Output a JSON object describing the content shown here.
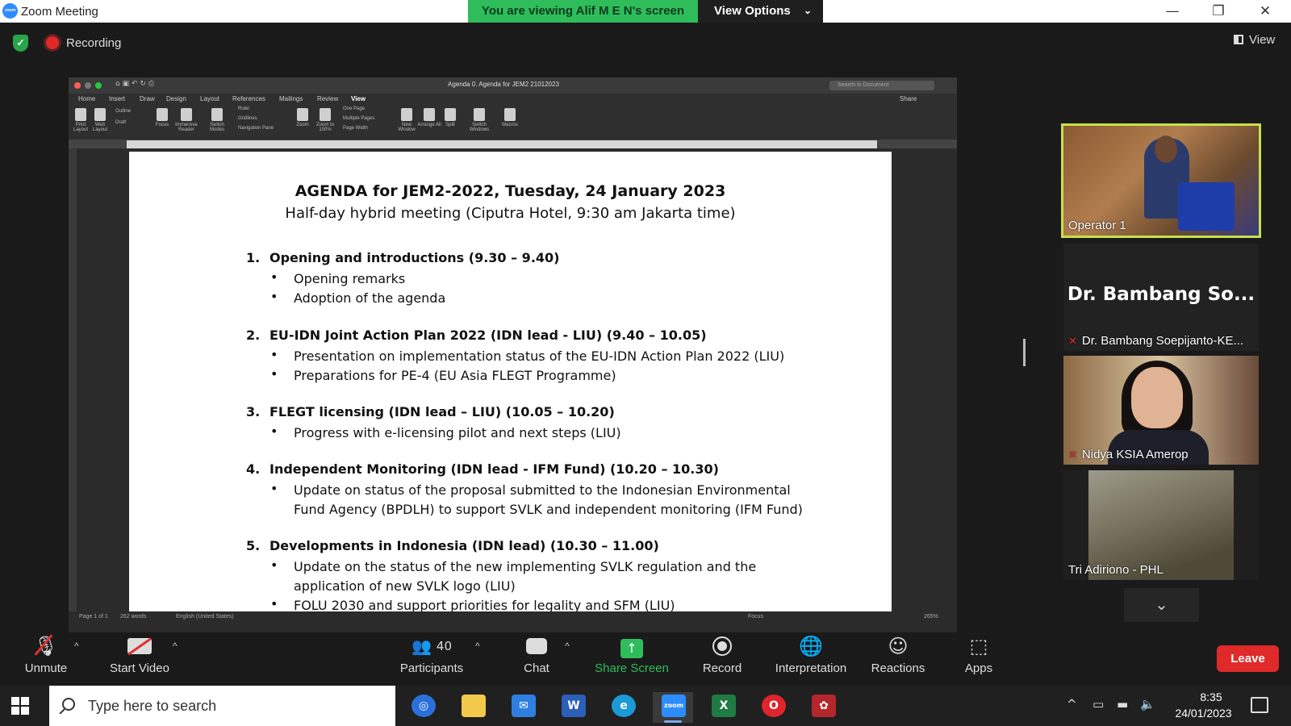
{
  "window": {
    "title": "Zoom Meeting",
    "logo_text": "zoom"
  },
  "banner": {
    "viewing_text": "You are viewing Alif M E N's screen",
    "view_options_label": "View Options"
  },
  "window_controls": {
    "minimize": "—",
    "restore": "❐",
    "close": "✕"
  },
  "meeting": {
    "recording_label": "Recording",
    "view_label": "View"
  },
  "word": {
    "doc_title": "Agenda 0. Agenda for JEM2 21012023",
    "search_placeholder": "Search in Document",
    "share_label": "Share",
    "tabs": [
      "Home",
      "Insert",
      "Draw",
      "Design",
      "Layout",
      "References",
      "Mailings",
      "Review",
      "View"
    ],
    "ribbon": [
      "Print Layout",
      "Web Layout",
      "Focus",
      "Immersive Reader",
      "Switch Modes",
      "Zoom",
      "Zoom to 100%",
      "New Window",
      "Arrange All",
      "Split",
      "Switch Windows",
      "Macros"
    ],
    "ribbon_checks": [
      "Outline",
      "Draft",
      "Ruler",
      "Gridlines",
      "Navigation Pane",
      "One Page",
      "Multiple Pages",
      "Page Width"
    ],
    "status": {
      "page": "Page 1 of 1",
      "words": "262 words",
      "language": "English (United States)",
      "focus": "Focus",
      "zoom": "265%"
    }
  },
  "document": {
    "heading": "AGENDA for JEM2-2022, Tuesday, 24 January 2023",
    "subheading": "Half-day hybrid meeting (Ciputra Hotel, 9:30 am Jakarta time)",
    "items": [
      {
        "num": "1.",
        "title": "Opening and introductions (9.30 – 9.40)",
        "bullets": [
          "Opening remarks",
          "Adoption of the agenda"
        ]
      },
      {
        "num": "2.",
        "title": "EU-IDN Joint Action Plan 2022 (IDN lead - LIU) (9.40 – 10.05)",
        "bullets": [
          "Presentation on implementation status of the EU-IDN Action Plan 2022 (LIU)",
          "Preparations for PE-4 (EU Asia FLEGT Programme)"
        ]
      },
      {
        "num": "3.",
        "title": "FLEGT licensing (IDN lead – LIU) (10.05 – 10.20)",
        "bullets": [
          "Progress with e-licensing pilot and next steps (LIU)"
        ]
      },
      {
        "num": "4.",
        "title": "Independent Monitoring (IDN lead - IFM Fund) (10.20 – 10.30)",
        "bullets": [
          "Update on status of the proposal submitted to the Indonesian Environmental Fund Agency (BPDLH) to support SVLK and independent monitoring (IFM Fund)"
        ]
      },
      {
        "num": "5.",
        "title": "Developments in Indonesia (IDN lead) (10.30 – 11.00)",
        "bullets": [
          "Update on the status of the new implementing SVLK regulation and the application of new SVLK logo (LIU)",
          "FOLU 2030 and support priorities for legality and SFM (LIU)"
        ]
      }
    ]
  },
  "participants": {
    "operator": "Operator 1",
    "bambang_big": "Dr. Bambang So...",
    "bambang": "Dr. Bambang Soepijanto-KE...",
    "nidya": "Nidya KSIA Amerop",
    "tri": "Tri Adiriono - PHL"
  },
  "toolbar": {
    "unmute": "Unmute",
    "start_video": "Start Video",
    "participants": "Participants",
    "participants_count": "40",
    "chat": "Chat",
    "share_screen": "Share Screen",
    "record": "Record",
    "interpretation": "Interpretation",
    "reactions": "Reactions",
    "apps": "Apps",
    "leave": "Leave"
  },
  "taskbar": {
    "search_placeholder": "Type here to search",
    "time": "8:35",
    "date": "24/01/2023",
    "apps": [
      "outlook-app",
      "file-explorer",
      "mail-app",
      "word-app",
      "edge-browser",
      "zoom-app",
      "excel-app",
      "opera-browser",
      "game-app"
    ]
  },
  "colors": {
    "accent_green": "#2ebd5a",
    "leave_red": "#e02a2a",
    "active_speaker": "#c7e04a"
  }
}
